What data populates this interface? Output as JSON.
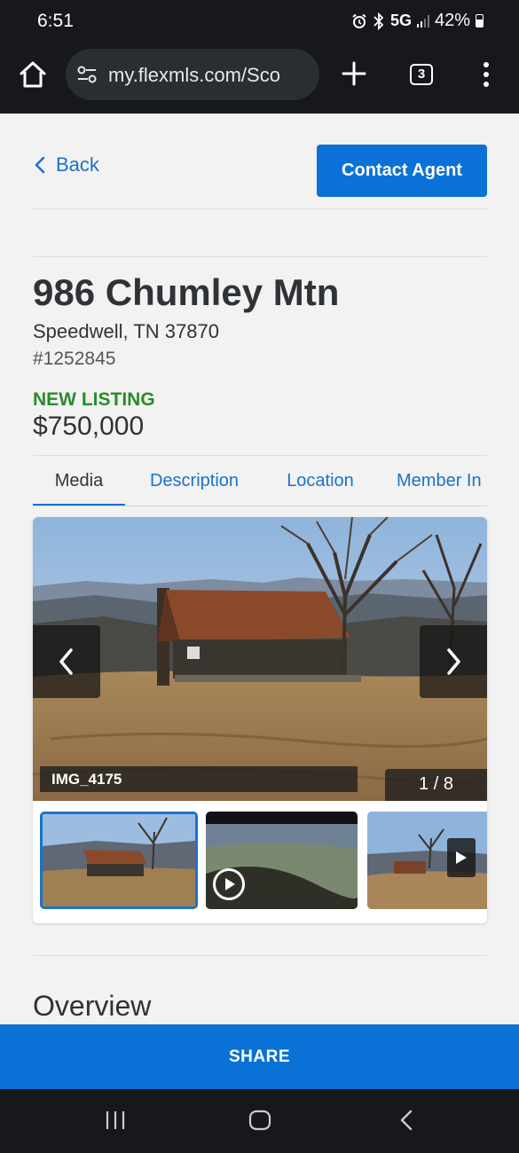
{
  "status_bar": {
    "time": "6:51",
    "network": "5G",
    "battery": "42%",
    "icons": [
      "alarm-icon",
      "bluetooth-icon",
      "signal-icon",
      "battery-icon"
    ]
  },
  "browser": {
    "url": "my.flexmls.com/Sco",
    "tab_count": "3",
    "icons": [
      "home-icon",
      "site-settings-icon",
      "new-tab-icon",
      "tab-switcher-icon",
      "more-menu-icon"
    ]
  },
  "header": {
    "back_label": "Back",
    "contact_label": "Contact Agent"
  },
  "listing": {
    "title": "986 Chumley Mtn",
    "city_line": "Speedwell, TN 37870",
    "mls_number": "#1252845",
    "status": "NEW LISTING",
    "price": "$750,000"
  },
  "tabs": [
    {
      "label": "Media",
      "active": true
    },
    {
      "label": "Description",
      "active": false
    },
    {
      "label": "Location",
      "active": false
    },
    {
      "label": "Member In",
      "active": false
    }
  ],
  "gallery": {
    "caption": "IMG_4175",
    "counter": "1 / 8",
    "thumbnails": [
      {
        "kind": "photo",
        "selected": true
      },
      {
        "kind": "video",
        "selected": false
      },
      {
        "kind": "photo",
        "selected": false
      }
    ]
  },
  "sections": {
    "overview_heading": "Overview"
  },
  "footer": {
    "share_label": "SHARE"
  },
  "colors": {
    "accent": "#0a72d6",
    "link": "#1a73c9",
    "new_listing": "#2b8a2b",
    "system_bar": "#16181b"
  }
}
